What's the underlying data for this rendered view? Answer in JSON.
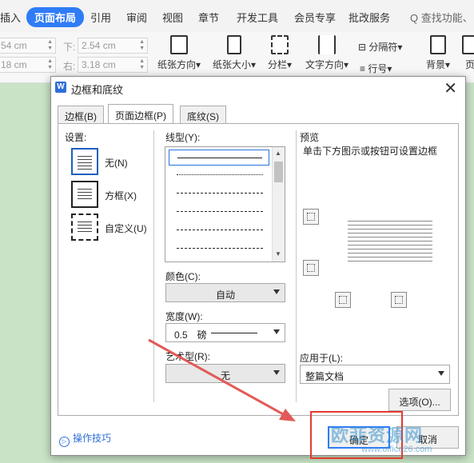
{
  "menubar": {
    "items": [
      {
        "label": "插入"
      },
      {
        "label": "页面布局"
      },
      {
        "label": "引用"
      },
      {
        "label": "审阅"
      },
      {
        "label": "视图"
      },
      {
        "label": "章节"
      },
      {
        "label": "开发工具"
      },
      {
        "label": "会员专享"
      },
      {
        "label": "批改服务"
      }
    ],
    "search": "Q 查找功能、"
  },
  "toolbar": {
    "margin_top_value": "54 cm",
    "margin_bottom_label": "下:",
    "margin_bottom_value": "2.54 cm",
    "margin_left_value": "18 cm",
    "margin_right_label": "右:",
    "margin_right_value": "3.18 cm",
    "orientation": "纸张方向",
    "paper_size": "纸张大小",
    "columns": "分栏",
    "text_direction": "文字方向",
    "separator": "分隔符",
    "line_number": "行号",
    "background": "背景",
    "page_border": "页"
  },
  "dialog": {
    "title": "边框和底纹",
    "tabs": [
      "边框(B)",
      "页面边框(P)",
      "底纹(S)"
    ],
    "settings_label": "设置:",
    "settings": [
      {
        "label": "无(N)"
      },
      {
        "label": "方框(X)"
      },
      {
        "label": "自定义(U)"
      }
    ],
    "line_style_label": "线型(Y):",
    "color_label": "颜色(C):",
    "color_value": "自动",
    "width_label": "宽度(W):",
    "width_value": "0.5　磅",
    "art_label": "艺术型(R):",
    "art_value": "无",
    "preview_label": "预览",
    "preview_hint": "单击下方图示或按钮可设置边框",
    "apply_label": "应用于(L):",
    "apply_value": "整篇文档",
    "options_button": "选项(O)...",
    "tips": "操作技巧",
    "ok_button": "确定",
    "cancel_button": "取消"
  },
  "watermark": {
    "text": "欧菲资源网",
    "url": "www.office26.com"
  },
  "colors": {
    "accent": "#2f7cf6",
    "highlight_box": "#e53a2e",
    "page_background": "#c8e3c6"
  }
}
